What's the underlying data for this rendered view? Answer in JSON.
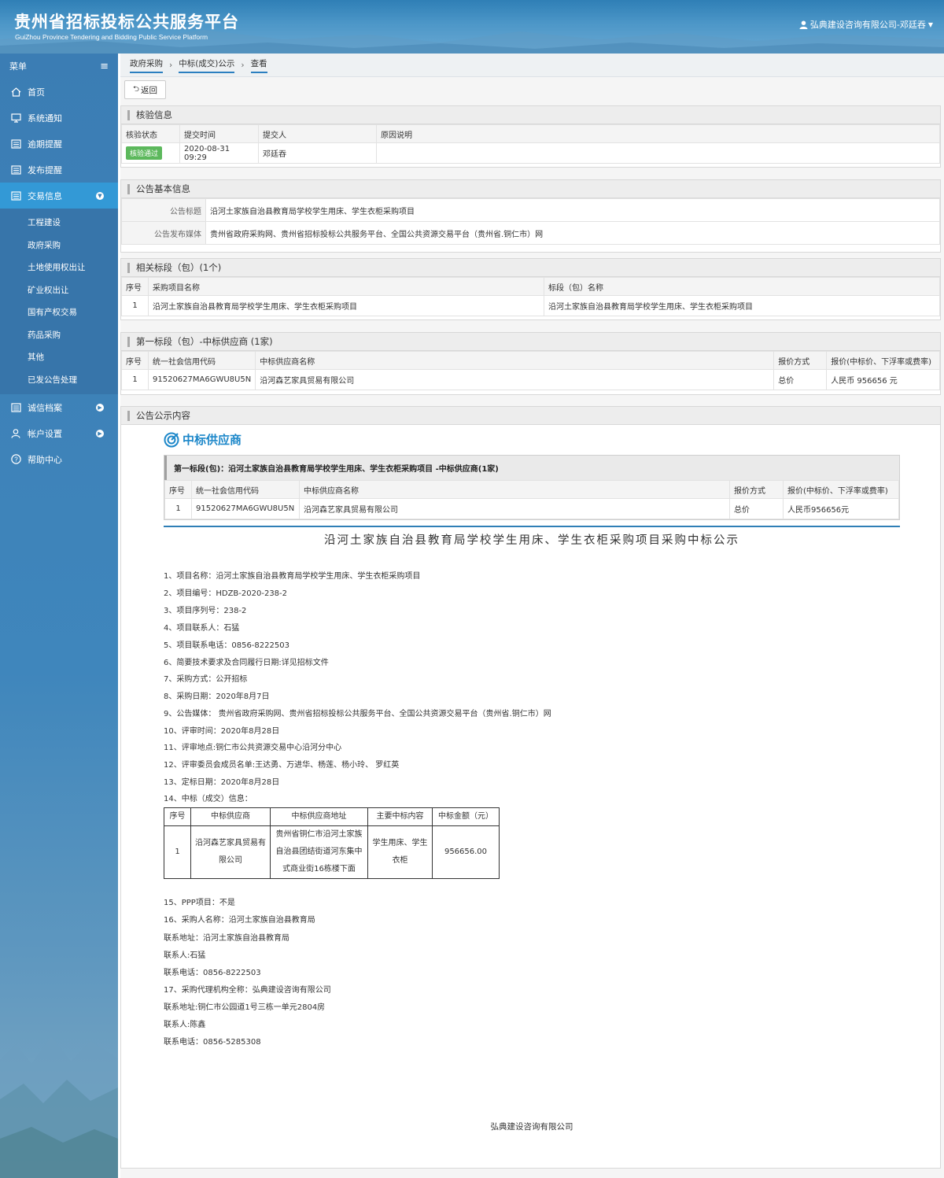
{
  "header": {
    "title": "贵州省招标投标公共服务平台",
    "subtitle": "GuiZhou Province Tendering and Bidding Public Service Platform",
    "user": "弘典建设咨询有限公司-邓廷吞"
  },
  "sidebar": {
    "menu_label": "菜单",
    "items": [
      {
        "label": "首页"
      },
      {
        "label": "系统通知"
      },
      {
        "label": "逾期提醒"
      },
      {
        "label": "发布提醒"
      },
      {
        "label": "交易信息"
      },
      {
        "label": "诚信档案"
      },
      {
        "label": "帐户设置"
      },
      {
        "label": "帮助中心"
      }
    ],
    "sub_items": [
      {
        "label": "工程建设"
      },
      {
        "label": "政府采购"
      },
      {
        "label": "土地使用权出让"
      },
      {
        "label": "矿业权出让"
      },
      {
        "label": "国有产权交易"
      },
      {
        "label": "药品采购"
      },
      {
        "label": "其他"
      },
      {
        "label": "已发公告处理"
      }
    ]
  },
  "breadcrumb": [
    "政府采购",
    "中标(成交)公示",
    "查看"
  ],
  "back_label": "返回",
  "verify": {
    "title": "核验信息",
    "headers": [
      "核验状态",
      "提交时间",
      "提交人",
      "原因说明"
    ],
    "status": "核验通过",
    "time": "2020-08-31 09:29",
    "submitter": "邓廷吞",
    "reason": ""
  },
  "basic": {
    "title": "公告基本信息",
    "rows": [
      {
        "label": "公告标题",
        "value": "沿河土家族自治县教育局学校学生用床、学生衣柜采购项目"
      },
      {
        "label": "公告发布媒体",
        "value": "贵州省政府采购网、贵州省招标投标公共服务平台、全国公共资源交易平台（贵州省.铜仁市）网"
      }
    ]
  },
  "sections": {
    "title": "相关标段（包）(1个)",
    "headers": [
      "序号",
      "采购项目名称",
      "标段（包）名称"
    ],
    "row": [
      "1",
      "沿河土家族自治县教育局学校学生用床、学生衣柜采购项目",
      "沿河土家族自治县教育局学校学生用床、学生衣柜采购项目"
    ]
  },
  "winner": {
    "title": "第一标段（包）-中标供应商 (1家)",
    "headers": [
      "序号",
      "统一社会信用代码",
      "中标供应商名称",
      "报价方式",
      "报价(中标价、下浮率或费率)"
    ],
    "row": [
      "1",
      "91520627MA6GWU8U5N",
      "沿河森艺家具贸易有限公司",
      "总价",
      "人民币 956656 元"
    ]
  },
  "notice": {
    "title": "公告公示内容",
    "win_heading": "中标供应商",
    "box_title": "第一标段(包)：沿河土家族自治县教育局学校学生用床、学生衣柜采购项目 -中标供应商(1家)",
    "box_headers": [
      "序号",
      "统一社会信用代码",
      "中标供应商名称",
      "报价方式",
      "报价(中标价、下浮率或费率)"
    ],
    "box_row": [
      "1",
      "91520627MA6GWU8U5N",
      "沿河森艺家具贸易有限公司",
      "总价",
      "人民币956656元"
    ],
    "article_title": "沿河土家族自治县教育局学校学生用床、学生衣柜采购项目采购中标公示",
    "lines_a": [
      "1、项目名称：沿河土家族自治县教育局学校学生用床、学生衣柜采购项目",
      "2、项目编号：HDZB-2020-238-2",
      "3、项目序列号：238-2",
      "4、项目联系人：石猛",
      "5、项目联系电话：0856-8222503",
      "6、简要技术要求及合同履行日期:详见招标文件",
      "7、采购方式：公开招标",
      "8、采购日期：2020年8月7日",
      "9、公告媒体： 贵州省政府采购网、贵州省招标投标公共服务平台、全国公共资源交易平台（贵州省.铜仁市）网",
      "10、评审时间：2020年8月28日",
      "11、评审地点:铜仁市公共资源交易中心沿河分中心",
      "12、评审委员会成员名单:王达勇、万进华、杨莲、杨小玲、 罗红英",
      " 13、定标日期：2020年8月28日",
      "14、中标（成交）信息："
    ],
    "win_table": {
      "headers": [
        "序号",
        "中标供应商",
        "中标供应商地址",
        "主要中标内容",
        "中标金额（元）"
      ],
      "row": [
        "1",
        "沿河森艺家具贸易有限公司",
        "贵州省铜仁市沿河土家族自治县团结街道河东集中式商业街16栋楼下面",
        "学生用床、学生衣柜",
        "956656.00"
      ]
    },
    "lines_b": [
      "15、PPP项目：不是",
      "16、采购人名称：沿河土家族自治县教育局",
      "联系地址：沿河土家族自治县教育局",
      "联系人:石猛",
      "联系电话：0856-8222503",
      "17、采购代理机构全称：弘典建设咨询有限公司",
      "联系地址:铜仁市公园道1号三栋一单元2804房",
      "联系人:陈鑫",
      "联系电话：0856-5285308"
    ],
    "signature": "弘典建设咨询有限公司"
  }
}
